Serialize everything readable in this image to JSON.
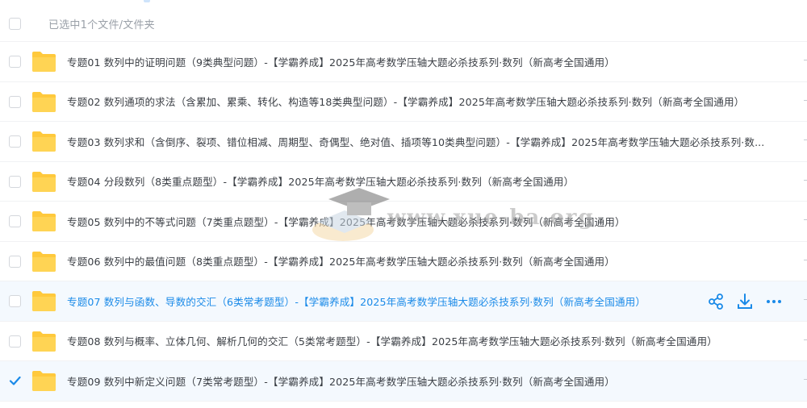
{
  "header": {
    "selection_label": "已选中1个文件/文件夹"
  },
  "files": [
    {
      "name": "专题01 数列中的证明问题（9类典型问题）-【学霸养成】2025年高考数学压轴大题必杀技系列·数列（新高考全国通用）",
      "type": "folder",
      "checked": false
    },
    {
      "name": "专题02 数列通项的求法（含累加、累乘、转化、构造等18类典型问题）-【学霸养成】2025年高考数学压轴大题必杀技系列·数列（新高考全国通用）",
      "type": "folder",
      "checked": false
    },
    {
      "name": "专题03 数列求和（含倒序、裂项、错位相减、周期型、奇偶型、绝对值、插项等10类典型问题）-【学霸养成】2025年高考数学压轴大题必杀技系列·数...",
      "type": "folder",
      "checked": false
    },
    {
      "name": "专题04 分段数列（8类重点题型）-【学霸养成】2025年高考数学压轴大题必杀技系列·数列（新高考全国通用）",
      "type": "folder",
      "checked": false
    },
    {
      "name": "专题05 数列中的不等式问题（7类重点题型）-【学霸养成】2025年高考数学压轴大题必杀技系列·数列（新高考全国通用）",
      "type": "folder",
      "checked": false
    },
    {
      "name": "专题06 数列中的最值问题（8类重点题型）-【学霸养成】2025年高考数学压轴大题必杀技系列·数列（新高考全国通用）",
      "type": "folder",
      "checked": false
    },
    {
      "name": "专题07 数列与函数、导数的交汇（6类常考题型）-【学霸养成】2025年高考数学压轴大题必杀技系列·数列（新高考全国通用）",
      "type": "folder",
      "checked": false,
      "hovered": true
    },
    {
      "name": "专题08 数列与概率、立体几何、解析几何的交汇（5类常考题型）-【学霸养成】2025年高考数学压轴大题必杀技系列·数列（新高考全国通用）",
      "type": "folder",
      "checked": false
    },
    {
      "name": "专题09 数列中新定义问题（7类常考题型）-【学霸养成】2025年高考数学压轴大题必杀技系列·数列（新高考全国通用）",
      "type": "folder",
      "checked": true
    }
  ],
  "row_actions": [
    "share-icon",
    "download-icon",
    "more-icon"
  ],
  "watermark": {
    "text": "www.xue-ba.org"
  },
  "colors": {
    "accent": "#1a8ae8",
    "folder": "#ffc93c",
    "row_highlight": "#f4f9fe"
  }
}
